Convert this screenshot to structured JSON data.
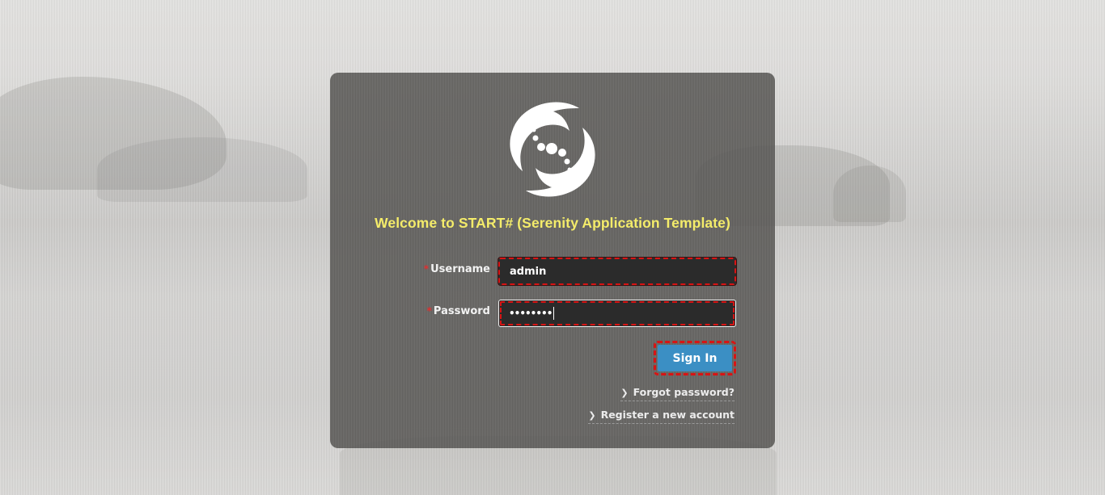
{
  "login": {
    "welcome": "Welcome to START# (Serenity Application Template)",
    "logo_icon": "serenity-swirl-logo",
    "required_mark": "*",
    "username_label": "Username",
    "username_value": "admin",
    "password_label": "Password",
    "password_masked": "••••••••",
    "signin_label": "Sign In",
    "forgot_link": "Forgot password?",
    "register_link": "Register a new account"
  },
  "colors": {
    "welcome_text": "#f4ec6a",
    "signin_button": "#3b8fc4",
    "validation_border": "#d81414",
    "panel": "#585654"
  }
}
